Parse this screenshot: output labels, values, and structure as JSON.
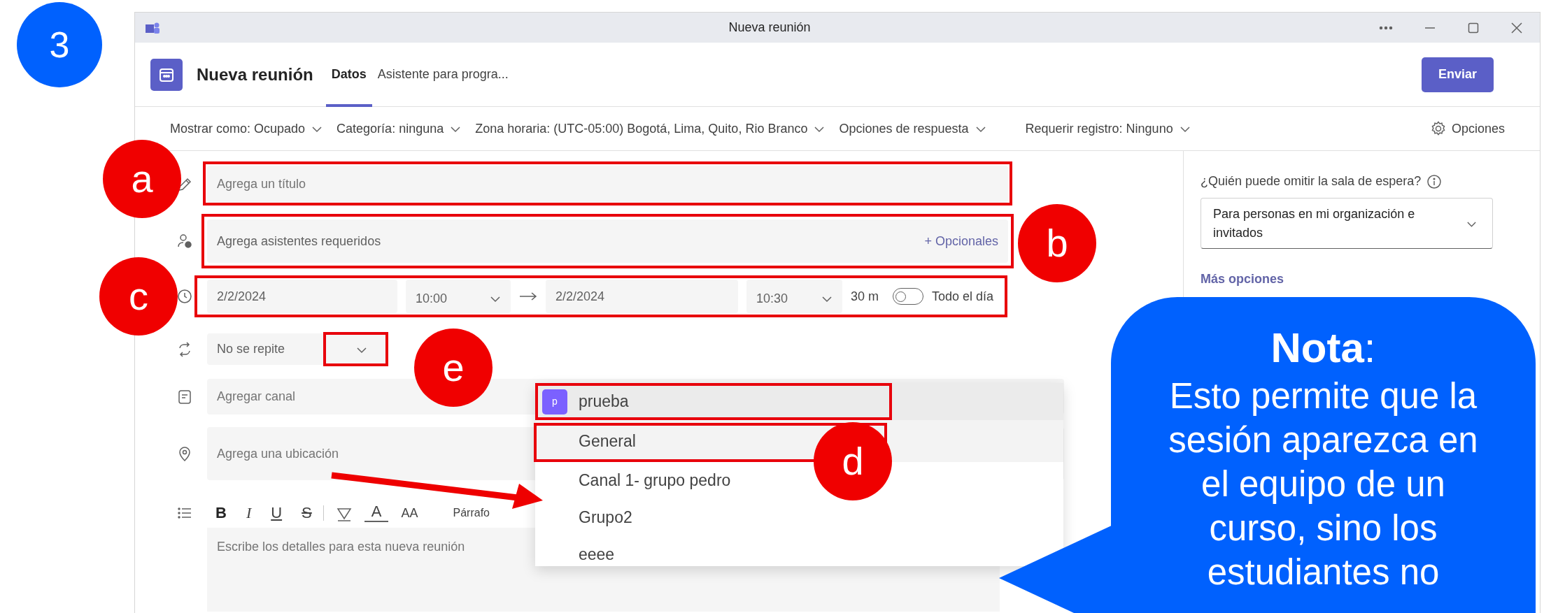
{
  "step_badge": "3",
  "window": {
    "title": "Nueva reunión"
  },
  "header": {
    "title": "Nueva reunión",
    "tabs": [
      {
        "label": "Datos",
        "selected": true
      },
      {
        "label": "Asistente para progra...",
        "selected": false
      }
    ],
    "send_button": "Enviar"
  },
  "options_bar": {
    "dropdowns": [
      "Mostrar como: Ocupado",
      "Categoría: ninguna",
      "Zona horaria: (UTC-05:00) Bogotá, Lima, Quito, Rio Branco",
      "Opciones de respuesta",
      "Requerir registro: Ninguno"
    ],
    "options_button": "Opciones"
  },
  "form": {
    "title_field": {
      "placeholder": "Agrega un título"
    },
    "attendees_field": {
      "placeholder": "Agrega asistentes requeridos",
      "optional_link": "+ Opcionales"
    },
    "schedule": {
      "start_date": "2/2/2024",
      "start_time": "10:00",
      "end_date": "2/2/2024",
      "end_time": "10:30",
      "duration": "30 m",
      "all_day": {
        "label": "Todo el día",
        "on": false
      }
    },
    "repeat": "No se repite",
    "channel_field": {
      "placeholder": "Agregar canal"
    },
    "location_field": {
      "placeholder": "Agrega una ubicación"
    },
    "editor": {
      "toolbar": [
        {
          "kind": "bold",
          "glyph": "B"
        },
        {
          "kind": "italic",
          "glyph": "I"
        },
        {
          "kind": "underline",
          "glyph": "U"
        },
        {
          "kind": "strike",
          "glyph": "S"
        },
        {
          "kind": "highlight"
        },
        {
          "kind": "font_color",
          "glyph": "A"
        },
        {
          "kind": "font_size",
          "glyph": "AA"
        }
      ],
      "paragraph_style": "Párrafo",
      "placeholder": "Escribe los detalles para esta nueva reunión"
    }
  },
  "channel_dropdown": {
    "team": {
      "initial": "p",
      "name": "prueba"
    },
    "channels": [
      {
        "name": "General",
        "selected": true
      },
      {
        "name": "Canal 1- grupo pedro",
        "selected": false
      },
      {
        "name": "Grupo2",
        "selected": false
      },
      {
        "name": "eeee",
        "selected": false
      }
    ]
  },
  "side_panel": {
    "lobby_label": "¿Quién puede omitir la sala de espera?",
    "lobby_value": "Para personas en mi organización e invitados",
    "more_options": "Más opciones"
  },
  "annotations": {
    "markers": [
      {
        "label": "a"
      },
      {
        "label": "b"
      },
      {
        "label": "c"
      },
      {
        "label": "e"
      },
      {
        "label": "d"
      }
    ],
    "note": {
      "title": "**Nota**:",
      "text": "Esto permite que la sesión aparezca en el equipo de un curso, sino los estudiantes no"
    }
  }
}
